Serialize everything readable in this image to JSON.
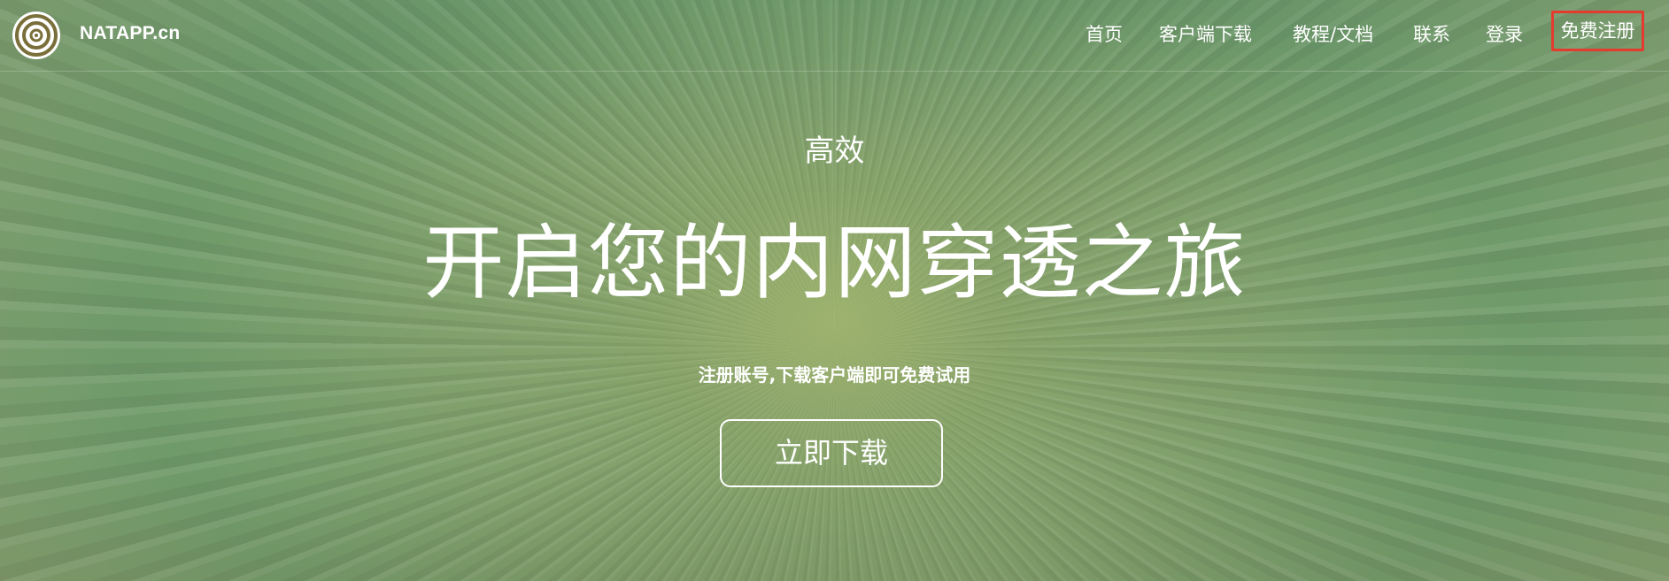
{
  "brand": {
    "logo_icon": "concentric-circles-logo",
    "name": "NATAPP.cn"
  },
  "nav": {
    "home": "首页",
    "client_download": "客户端下载",
    "docs": "教程/文档",
    "contact": "联系",
    "login": "登录",
    "register": "免费注册"
  },
  "hero": {
    "subtitle": "高效",
    "headline": "开启您的内网穿透之旅",
    "tagline": "注册账号,下载客户端即可免费试用",
    "download_button": "立即下载"
  },
  "colors": {
    "register_highlight": "#e53b2f",
    "text": "#ffffff",
    "background_green": "#7fa06c"
  }
}
